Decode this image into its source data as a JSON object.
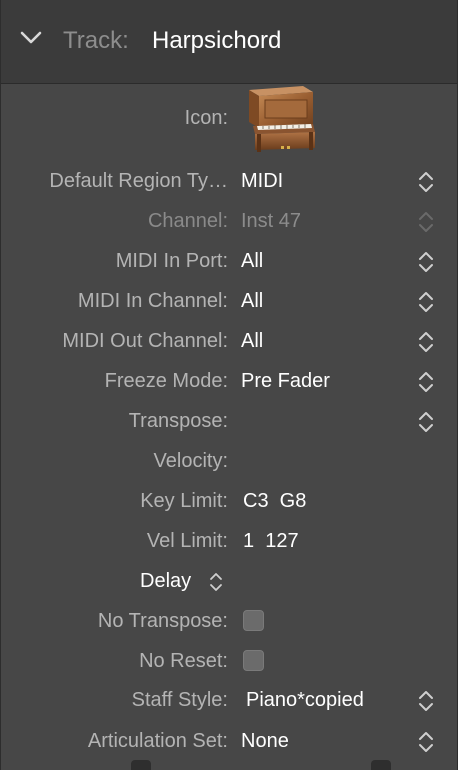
{
  "header": {
    "label": "Track:",
    "name": "Harpsichord"
  },
  "icon_row": {
    "label": "Icon:"
  },
  "rows": {
    "default_region": {
      "label": "Default Region Ty…",
      "value": "MIDI"
    },
    "channel": {
      "label": "Channel:",
      "value": "Inst 47"
    },
    "midi_in_port": {
      "label": "MIDI In Port:",
      "value": "All"
    },
    "midi_in_channel": {
      "label": "MIDI In Channel:",
      "value": "All"
    },
    "midi_out_channel": {
      "label": "MIDI Out Channel:",
      "value": "All"
    },
    "freeze_mode": {
      "label": "Freeze Mode:",
      "value": "Pre Fader"
    },
    "transpose": {
      "label": "Transpose:",
      "value": ""
    },
    "velocity": {
      "label": "Velocity:",
      "value": ""
    },
    "key_limit": {
      "label": "Key Limit:",
      "value": "C3  G8"
    },
    "vel_limit": {
      "label": "Vel Limit:",
      "value": "1  127"
    },
    "delay": {
      "label": "Delay"
    },
    "no_transpose": {
      "label": "No Transpose:",
      "checked": false
    },
    "no_reset": {
      "label": "No Reset:",
      "checked": false
    },
    "staff_style": {
      "label": "Staff Style:",
      "value": "Piano*copied"
    },
    "articulation_set": {
      "label": "Articulation Set:",
      "value": "None"
    }
  },
  "icons": {
    "collapse": "chevron-down-icon",
    "track_icon": "upright-piano-icon",
    "stepper": "up-down-stepper-icon"
  },
  "colors": {
    "panel_bg": "#474747",
    "header_bg": "#3b3b3b",
    "label": "#b4b4b4",
    "value": "#ffffff",
    "dim": "#8a8a8a"
  }
}
